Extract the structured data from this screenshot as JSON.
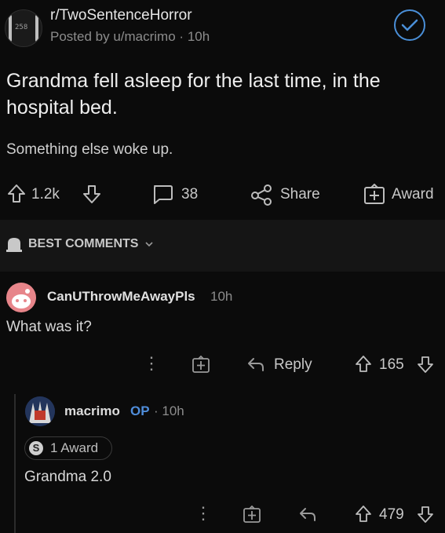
{
  "post": {
    "subreddit": "r/TwoSentenceHorror",
    "subreddit_icon_text": "258",
    "posted_by": "Posted by u/macrimo",
    "time": "10h",
    "title": "Grandma fell asleep for the last time, in the hospital bed.",
    "body": "Something else woke up.",
    "upvotes": "1.2k",
    "comments": "38",
    "share_label": "Share",
    "award_label": "Award"
  },
  "sort": {
    "label": "BEST COMMENTS"
  },
  "comment": {
    "user": "CanUThrowMeAwayPls",
    "time": "10h",
    "text": "What was it?",
    "reply_label": "Reply",
    "score": "165"
  },
  "reply": {
    "user": "macrimo",
    "op_tag": "OP",
    "time": "10h",
    "award": "1 Award",
    "award_coin": "S",
    "text": "Grandma 2.0",
    "score": "479"
  },
  "colors": {
    "accent": "#4f8dda",
    "background": "#0b0b0b",
    "avatar_comment": "#e7858a"
  },
  "icons": [
    "subreddit-icon",
    "joined-check-icon",
    "upvote-icon",
    "downvote-icon",
    "comment-icon",
    "share-icon",
    "award-icon",
    "mod-shield-icon",
    "chevron-down-icon",
    "more-icon",
    "reply-icon"
  ]
}
